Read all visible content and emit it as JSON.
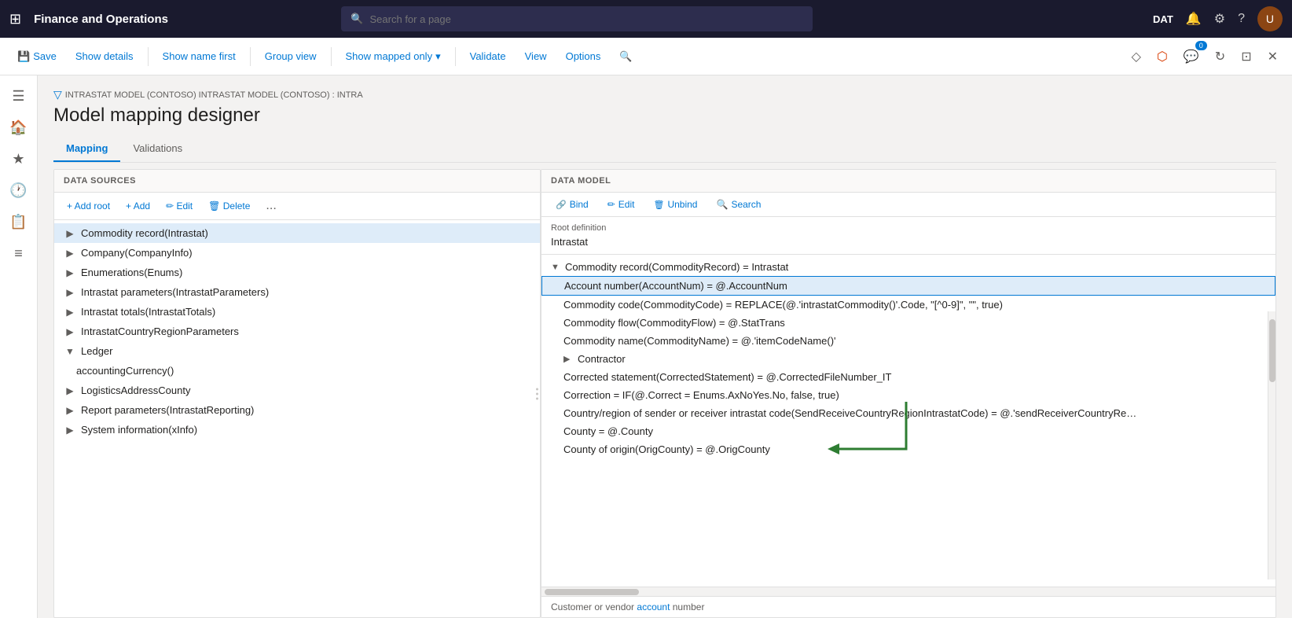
{
  "app": {
    "title": "Finance and Operations",
    "environment": "DAT",
    "search_placeholder": "Search for a page"
  },
  "command_bar": {
    "save_label": "Save",
    "show_details_label": "Show details",
    "show_name_first_label": "Show name first",
    "group_view_label": "Group view",
    "show_mapped_only_label": "Show mapped only",
    "validate_label": "Validate",
    "view_label": "View",
    "options_label": "Options",
    "notifications_badge": "0"
  },
  "breadcrumb": {
    "path": "INTRASTAT MODEL (CONTOSO) INTRASTAT MODEL (CONTOSO) : INTRA"
  },
  "page": {
    "title": "Model mapping designer"
  },
  "tabs": [
    {
      "label": "Mapping",
      "active": true
    },
    {
      "label": "Validations",
      "active": false
    }
  ],
  "data_sources": {
    "header": "DATA SOURCES",
    "toolbar": {
      "add_root": "+ Add root",
      "add": "+ Add",
      "edit": "✏ Edit",
      "delete": "🗑 Delete",
      "more": "..."
    },
    "items": [
      {
        "label": "Commodity record(Intrastat)",
        "level": 0,
        "expanded": false,
        "selected": true
      },
      {
        "label": "Company(CompanyInfo)",
        "level": 0,
        "expanded": false,
        "selected": false
      },
      {
        "label": "Enumerations(Enums)",
        "level": 0,
        "expanded": false,
        "selected": false
      },
      {
        "label": "Intrastat parameters(IntrastatParameters)",
        "level": 0,
        "expanded": false,
        "selected": false
      },
      {
        "label": "Intrastat totals(IntrastatTotals)",
        "level": 0,
        "expanded": false,
        "selected": false
      },
      {
        "label": "IntrastatCountryRegionParameters",
        "level": 0,
        "expanded": false,
        "selected": false
      },
      {
        "label": "Ledger",
        "level": 0,
        "expanded": true,
        "selected": false
      },
      {
        "label": "accountingCurrency()",
        "level": 1,
        "expanded": false,
        "selected": false
      },
      {
        "label": "LogisticsAddressCounty",
        "level": 0,
        "expanded": false,
        "selected": false
      },
      {
        "label": "Report parameters(IntrastatReporting)",
        "level": 0,
        "expanded": false,
        "selected": false
      },
      {
        "label": "System information(xInfo)",
        "level": 0,
        "expanded": false,
        "selected": false
      }
    ]
  },
  "data_model": {
    "header": "DATA MODEL",
    "toolbar": {
      "bind_label": "Bind",
      "edit_label": "Edit",
      "unbind_label": "Unbind",
      "search_label": "Search"
    },
    "root_definition": {
      "label": "Root definition",
      "value": "Intrastat"
    },
    "items": [
      {
        "label": "Commodity record(CommodityRecord) = Intrastat",
        "level": 0,
        "expanded": true,
        "selected": false
      },
      {
        "label": "Account number(AccountNum) = @.AccountNum",
        "level": 1,
        "expanded": false,
        "selected": true
      },
      {
        "label": "Commodity code(CommodityCode) = REPLACE(@.'intrastatCommodity()'.Code, \"[^0-9]\", \"\", true)",
        "level": 1,
        "expanded": false,
        "selected": false
      },
      {
        "label": "Commodity flow(CommodityFlow) = @.StatTrans",
        "level": 1,
        "expanded": false,
        "selected": false
      },
      {
        "label": "Commodity name(CommodityName) = @.'itemCodeName()'",
        "level": 1,
        "expanded": false,
        "selected": false
      },
      {
        "label": "Contractor",
        "level": 1,
        "expanded": false,
        "selected": false
      },
      {
        "label": "Corrected statement(CorrectedStatement) = @.CorrectedFileNumber_IT",
        "level": 1,
        "expanded": false,
        "selected": false
      },
      {
        "label": "Correction = IF(@.Correct = Enums.AxNoYes.No, false, true)",
        "level": 1,
        "expanded": false,
        "selected": false
      },
      {
        "label": "Country/region of sender or receiver intrastat code(SendReceiveCountryRegionIntrastatCode) = @.'sendReceiverCountryRe…",
        "level": 1,
        "expanded": false,
        "selected": false
      },
      {
        "label": "County = @.County",
        "level": 1,
        "expanded": false,
        "selected": false
      },
      {
        "label": "County of origin(OrigCounty) = @.OrigCounty",
        "level": 1,
        "expanded": false,
        "selected": false
      }
    ]
  },
  "bottom_bar": {
    "text": "Customer or vendor account number"
  },
  "left_nav": {
    "icons": [
      "☰",
      "🏠",
      "★",
      "🕐",
      "📋",
      "≡"
    ]
  }
}
